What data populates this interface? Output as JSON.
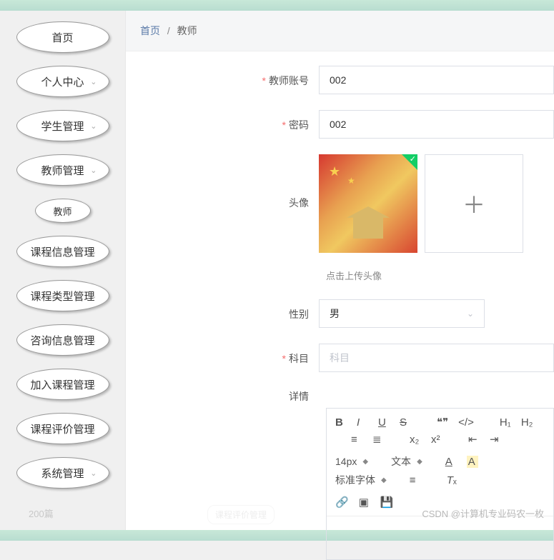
{
  "nav": {
    "items": [
      {
        "label": "首页",
        "hasChevron": false
      },
      {
        "label": "个人中心",
        "hasChevron": true
      },
      {
        "label": "学生管理",
        "hasChevron": true
      },
      {
        "label": "教师管理",
        "hasChevron": true
      },
      {
        "label": "课程信息管理",
        "hasChevron": true
      },
      {
        "label": "课程类型管理",
        "hasChevron": true
      },
      {
        "label": "咨询信息管理",
        "hasChevron": true
      },
      {
        "label": "加入课程管理",
        "hasChevron": true
      },
      {
        "label": "课程评价管理",
        "hasChevron": true
      },
      {
        "label": "系统管理",
        "hasChevron": true
      }
    ],
    "subItem": "教师"
  },
  "breadcrumb": {
    "home": "首页",
    "current": "教师"
  },
  "form": {
    "teacher_account": {
      "label": "教师账号",
      "value": "002"
    },
    "password": {
      "label": "密码",
      "value": "002"
    },
    "avatar": {
      "label": "头像",
      "upload_tip": "点击上传头像"
    },
    "gender": {
      "label": "性别",
      "value": "男"
    },
    "subject": {
      "label": "科目",
      "placeholder": "科目"
    },
    "detail": {
      "label": "详情"
    }
  },
  "editor_toolbar": {
    "font_size": "14px",
    "text_type": "文本",
    "font_family": "标准字体"
  },
  "watermark": "CSDN @计算机专业码农一枚",
  "footer": {
    "count": "200篇",
    "tag": "课程评价管理"
  }
}
